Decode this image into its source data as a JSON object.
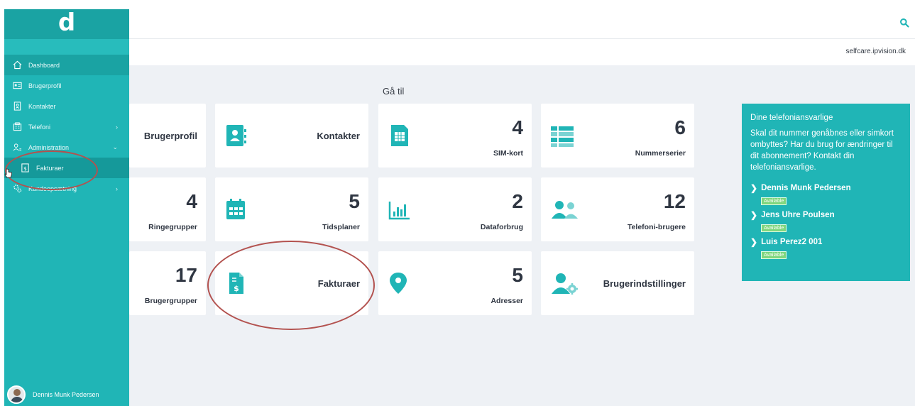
{
  "sidebar": {
    "logo": "d",
    "items": [
      {
        "label": "Dashboard",
        "icon": "home-icon"
      },
      {
        "label": "Brugerprofil",
        "icon": "id-card-icon"
      },
      {
        "label": "Kontakter",
        "icon": "contact-icon"
      },
      {
        "label": "Telefoni",
        "icon": "phone-icon",
        "arrow": "›"
      },
      {
        "label": "Administration",
        "icon": "admin-icon",
        "arrow": "⌄"
      },
      {
        "label": "Fakturaer",
        "icon": "invoice-icon"
      },
      {
        "label": "Kundeopsætning",
        "icon": "gears-icon",
        "arrow": "›"
      }
    ],
    "user_name": "Dennis Munk Pedersen"
  },
  "header": {
    "domain": "selfcare.ipvision.dk"
  },
  "main": {
    "goto_title": "Gå til",
    "cards": [
      {
        "label": "Brugerprofil",
        "icon": "user-card-icon"
      },
      {
        "label": "Kontakter",
        "icon": "address-book-icon"
      },
      {
        "count": "4",
        "label": "SIM-kort",
        "icon": "sim-card-icon"
      },
      {
        "count": "6",
        "label": "Nummerserier",
        "icon": "list-icon"
      },
      {
        "count": "4",
        "label": "Ringegrupper"
      },
      {
        "count": "5",
        "label": "Tidsplaner",
        "icon": "calendar-icon"
      },
      {
        "count": "2",
        "label": "Dataforbrug",
        "icon": "bar-chart-icon"
      },
      {
        "count": "12",
        "label": "Telefoni-brugere",
        "icon": "users-icon"
      },
      {
        "count": "17",
        "label": "Brugergrupper"
      },
      {
        "label": "Fakturaer",
        "icon": "invoice-doc-icon"
      },
      {
        "count": "5",
        "label": "Adresser",
        "icon": "location-pin-icon"
      },
      {
        "label": "Brugerindstillinger",
        "icon": "user-settings-icon"
      }
    ]
  },
  "panel": {
    "title": "Dine telefoniansvarlige",
    "text": "Skal dit nummer genåbnes eller simkort ombyttes? Har du brug for ændringer til dit abonnement? Kontakt din telefoniansvarlige.",
    "contacts": [
      {
        "name": "Dennis Munk Pedersen",
        "status": "Available"
      },
      {
        "name": "Jens Uhre Poulsen",
        "status": "Available"
      },
      {
        "name": "Luis Perez2 001",
        "status": "Available"
      }
    ]
  },
  "colors": {
    "teal": "#20b5b6",
    "teal_dark": "#1aa3a3",
    "background": "#eef1f5",
    "annotation": "#b3524f",
    "available": "#7fd67d"
  }
}
